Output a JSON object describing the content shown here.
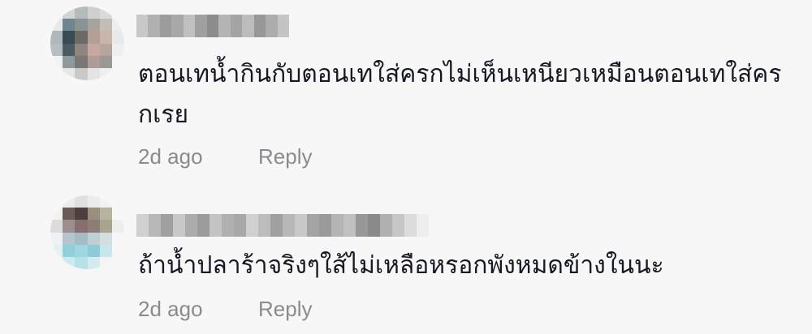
{
  "comments": [
    {
      "text": "ตอนเทน้ำกินกับตอนเทใส่ครกไม่เห็นเหนียวเหมือนตอนเทใส่ครกเรย",
      "time": "2d ago",
      "reply_label": "Reply",
      "avatar_colors": [
        "#f7f7f7",
        "#d3d5d5",
        "#b5babc",
        "#cfd1cf",
        "#dadada",
        "#f7f7f7",
        "#e8eae9",
        "#6f8590",
        "#8b9295",
        "#a9a39c",
        "#c4bdb6",
        "#eeeeee",
        "#aeb7bb",
        "#394b55",
        "#6d6965",
        "#b49f98",
        "#c9b5ad",
        "#e9e9e9",
        "#b7bec1",
        "#4d5a60",
        "#8e8580",
        "#c7a8a0",
        "#b6a59e",
        "#efefef",
        "#f2f2f2",
        "#8f9a9f",
        "#7a7774",
        "#b09c96",
        "#9a9995",
        "#f7f7f7",
        "#f7f7f7",
        "#e6e6e6",
        "#c9c9c9",
        "#e4e4e4",
        "#efefef",
        "#f7f7f7"
      ],
      "username_colors": [
        "#c8c8c8",
        "#b0b0b0",
        "#9c9c9c",
        "#a8a8a8",
        "#c0c0c0",
        "#a0a0a0",
        "#8c8c8c",
        "#b4b4b4",
        "#a4a4a4",
        "#bcbcbc",
        "#989898",
        "#acacac",
        "#c4c4c4"
      ]
    },
    {
      "text": "ถ้าน้ำปลาร้าจริงๆใส้ไม่เหลือหรอกพังหมดข้างในนะ",
      "time": "2d ago",
      "reply_label": "Reply",
      "avatar_colors": [
        "#f7f7f7",
        "#ececec",
        "#e0e0e0",
        "#ebebeb",
        "#f2f2f2",
        "#f7f7f7",
        "#f2f2f2",
        "#6b5a57",
        "#4e3f3f",
        "#9a8f7f",
        "#b8b39e",
        "#f7f7f7",
        "#dcdcdc",
        "#9d8f8d",
        "#886e6f",
        "#8b7f78",
        "#a9a48e",
        "#ededed",
        "#eef2f3",
        "#b6c5cb",
        "#a6bcc4",
        "#c0cfd3",
        "#d4dde0",
        "#f7f7f7",
        "#e2f1f4",
        "#8fd0dc",
        "#9fd6df",
        "#8fcbd6",
        "#c8e7ec",
        "#f7f7f7",
        "#f7f7f7",
        "#cdeaef",
        "#b6e1e8",
        "#d2ecf0",
        "#f1f5f6",
        "#f7f7f7"
      ],
      "username_colors": [
        "#d0d0d0",
        "#b8b8b8",
        "#a0a0a0",
        "#c8c8c8",
        "#acacac",
        "#9c9c9c",
        "#c4c4c4",
        "#b0b0b0",
        "#a8a8a8",
        "#d0d0d0",
        "#bcbcbc",
        "#a0a0a0",
        "#b8b8b8",
        "#c8c8c8",
        "#a4a4a4",
        "#9a9a9a",
        "#b4b4b4",
        "#c0c0c0",
        "#989898",
        "#8a8a8a",
        "#b0b0b0",
        "#c6c6c6",
        "#dcdcdc",
        "#eeeeee"
      ]
    }
  ]
}
